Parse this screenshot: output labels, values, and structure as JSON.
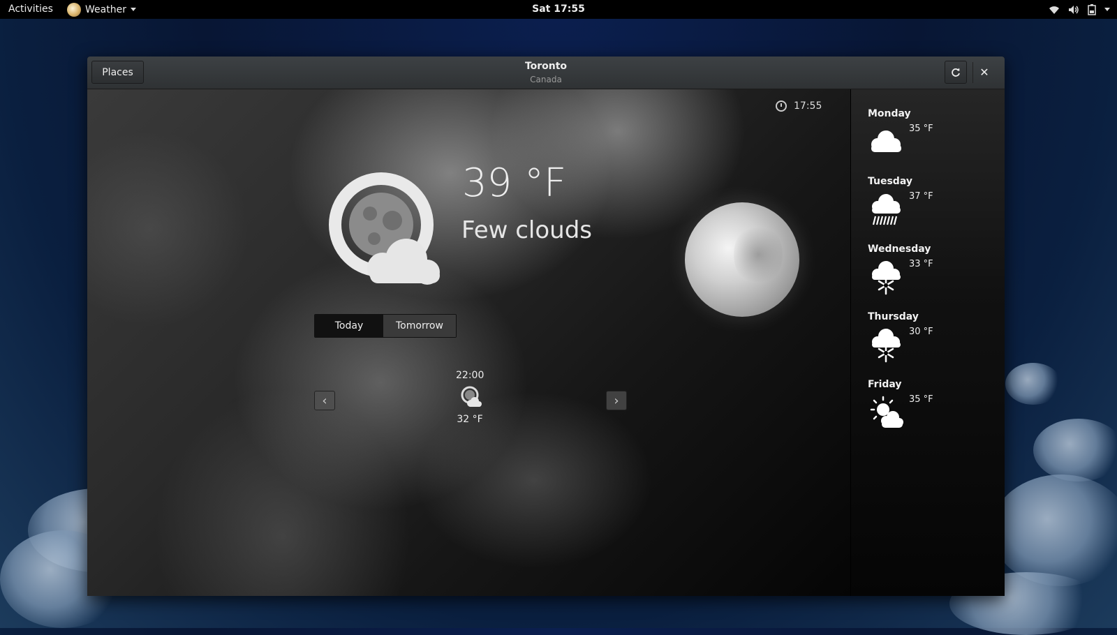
{
  "topbar": {
    "activities": "Activities",
    "app_menu": "Weather",
    "clock": "Sat 17:55"
  },
  "window": {
    "places_label": "Places",
    "city": "Toronto",
    "country": "Canada"
  },
  "current": {
    "updated_time": "17:55",
    "temperature": "39 °F",
    "condition": "Few clouds",
    "condition_icon": "moon-few-clouds-icon"
  },
  "tabs": {
    "today": "Today",
    "tomorrow": "Tomorrow",
    "active": "Today"
  },
  "hourly": [
    {
      "time": "22:00",
      "icon": "moon-few-clouds-icon",
      "temp": "32 °F"
    }
  ],
  "forecast": [
    {
      "day": "Monday",
      "temp": "35 °F",
      "icon": "cloud-icon"
    },
    {
      "day": "Tuesday",
      "temp": "37 °F",
      "icon": "rain-icon"
    },
    {
      "day": "Wednesday",
      "temp": "33 °F",
      "icon": "snow-icon"
    },
    {
      "day": "Thursday",
      "temp": "30 °F",
      "icon": "snow-icon"
    },
    {
      "day": "Friday",
      "temp": "35 °F",
      "icon": "sun-clouds-icon"
    }
  ]
}
